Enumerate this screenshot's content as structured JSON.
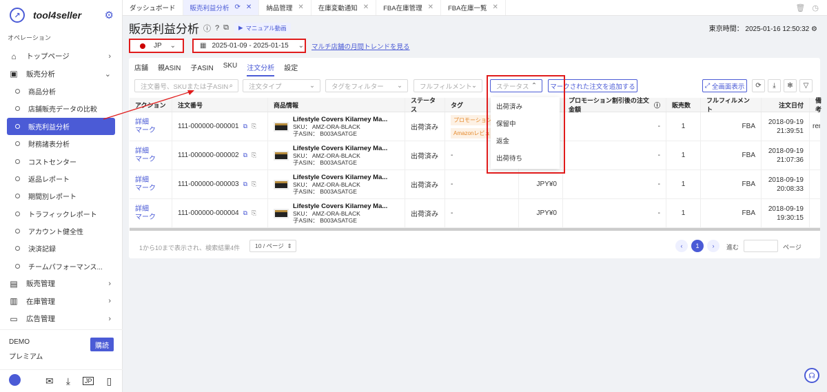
{
  "brand": {
    "name": "tool4seller",
    "color": "#4b5bd6",
    "highlight": "#e01b1b"
  },
  "sidebar": {
    "section": "オペレーション",
    "top_items": [
      {
        "label": "トップページ"
      },
      {
        "label": "販売分析"
      }
    ],
    "sub_items": [
      {
        "label": "商品分析"
      },
      {
        "label": "店舗販売データの比較"
      },
      {
        "label": "販売利益分析"
      },
      {
        "label": "財務諸表分析"
      },
      {
        "label": "コストセンター"
      },
      {
        "label": "返品レポート"
      },
      {
        "label": "期間別レポート"
      },
      {
        "label": "トラフィックレポート"
      },
      {
        "label": "アカウント健全性"
      },
      {
        "label": "決済記録"
      },
      {
        "label": "チームパフォーマンス..."
      }
    ],
    "bottom_items": [
      {
        "label": "販売管理"
      },
      {
        "label": "在庫管理"
      },
      {
        "label": "広告管理"
      }
    ],
    "plan": {
      "demo": "DEMO",
      "level": "プレミアム",
      "buy": "購読"
    }
  },
  "tabs": [
    {
      "label": "ダッシュボード"
    },
    {
      "label": "販売利益分析"
    },
    {
      "label": "納品管理"
    },
    {
      "label": "在庫変動通知"
    },
    {
      "label": "FBA在庫管理"
    },
    {
      "label": "FBA在庫一覧"
    }
  ],
  "page": {
    "title": "販売利益分析",
    "manual": "マニュアル動画",
    "clock": "東京時間： 2025-01-16 12:50:32"
  },
  "controls": {
    "country": "JP",
    "date_range": "2025-01-09 - 2025-01-15",
    "trend_link": "マルチ店舗の月間トレンドを見る"
  },
  "subtabs": [
    "店舗",
    "親ASIN",
    "子ASIN",
    "SKU",
    "注文分析",
    "設定"
  ],
  "filters": {
    "search": "注文番号、SKUまたは子ASIN",
    "order_type": "注文タイプ",
    "tag": "タグをフィルター",
    "fulfillment": "フルフィルメント",
    "status": "ステータス",
    "mark_btn": "マークされた注文を追加する",
    "fullscreen": "全画面表示"
  },
  "status_options": [
    "出荷済み",
    "保留中",
    "返金",
    "出荷待ち"
  ],
  "table": {
    "headers": [
      "アクション",
      "注文番号",
      "商品情報",
      "ステータス",
      "タグ",
      "",
      "プロモーション割引後の注文金額",
      "販売数",
      "フルフィルメント",
      "注文日付",
      "備考"
    ],
    "rows": [
      {
        "detail": "詳細",
        "mark": "マーク",
        "order": "111-000000-000001",
        "title": "Lifestyle Covers Kilarney Ma...",
        "sku": "SKU： AMZ-ORA-BLACK",
        "asin": "子ASIN： B003ASATGE",
        "status": "出荷済み",
        "tag1": "プロモーション",
        "tag2": "Amazonレビュ",
        "amount": "",
        "promo": "-",
        "qty": "1",
        "ful": "FBA",
        "date": "2018-09-19",
        "time": "21:39:51",
        "note": "rem"
      },
      {
        "detail": "詳細",
        "mark": "マーク",
        "order": "111-000000-000002",
        "title": "Lifestyle Covers Kilarney Ma...",
        "sku": "SKU： AMZ-ORA-BLACK",
        "asin": "子ASIN： B003ASATGE",
        "status": "出荷済み",
        "tag1": "-",
        "tag2": "",
        "amount": "",
        "promo": "-",
        "qty": "1",
        "ful": "FBA",
        "date": "2018-09-19",
        "time": "21:07:36",
        "note": ""
      },
      {
        "detail": "詳細",
        "mark": "マーク",
        "order": "111-000000-000003",
        "title": "Lifestyle Covers Kilarney Ma...",
        "sku": "SKU： AMZ-ORA-BLACK",
        "asin": "子ASIN： B003ASATGE",
        "status": "出荷済み",
        "tag1": "-",
        "tag2": "",
        "amount": "JPY¥0",
        "promo": "-",
        "qty": "1",
        "ful": "FBA",
        "date": "2018-09-19",
        "time": "20:08:33",
        "note": ""
      },
      {
        "detail": "詳細",
        "mark": "マーク",
        "order": "111-000000-000004",
        "title": "Lifestyle Covers Kilarney Ma...",
        "sku": "SKU： AMZ-ORA-BLACK",
        "asin": "子ASIN： B003ASATGE",
        "status": "出荷済み",
        "tag1": "-",
        "tag2": "",
        "amount": "JPY¥0",
        "promo": "-",
        "qty": "1",
        "ful": "FBA",
        "date": "2018-09-19",
        "time": "19:30:15",
        "note": ""
      }
    ]
  },
  "pager": {
    "info": "1から10まで表示され、検索結果4件",
    "size": "10 / ページ",
    "current": "1",
    "goto": "進む",
    "page_label": "ページ"
  }
}
